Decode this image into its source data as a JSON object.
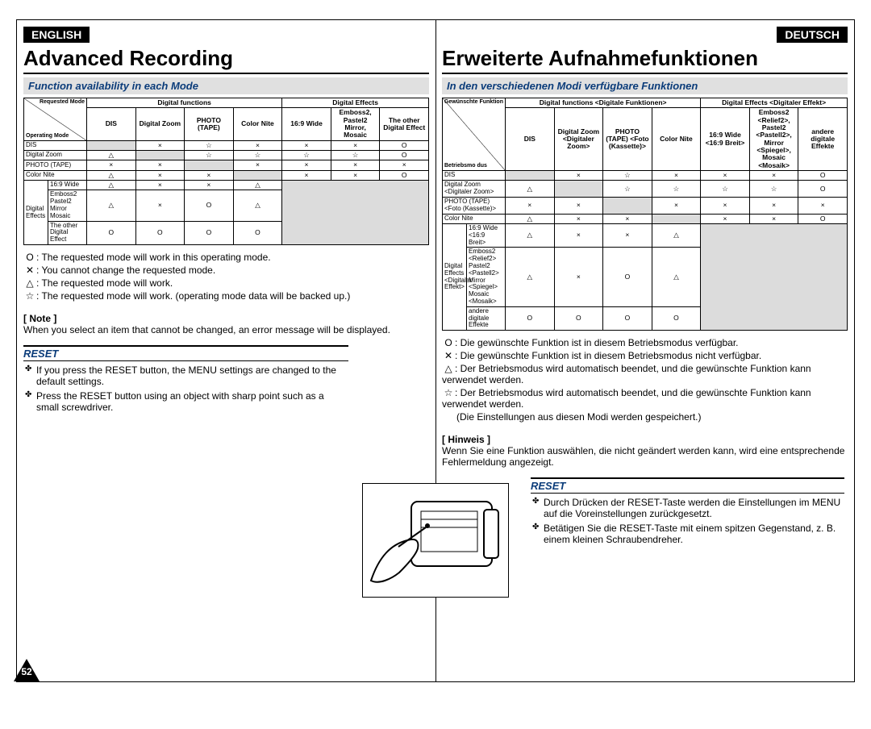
{
  "page_number": "52",
  "en": {
    "lang": "ENGLISH",
    "title": "Advanced Recording",
    "subhead": "Function availability in each Mode",
    "table": {
      "diag_top": "Requested Mode",
      "diag_left": "Operating Mode",
      "group1": "Digital functions",
      "group2": "Digital Effects",
      "cols": [
        "DIS",
        "Digital Zoom",
        "PHOTO (TAPE)",
        "Color Nite",
        "16:9 Wide",
        "Emboss2, Pastel2 Mirror, Mosaic",
        "The other Digital Effect"
      ],
      "rows": [
        {
          "h": "DIS",
          "sh": true,
          "c": [
            "",
            "×",
            "☆",
            "×",
            "×",
            "×",
            "O"
          ]
        },
        {
          "h": "Digital Zoom",
          "sh": false,
          "c": [
            "△",
            "",
            "☆",
            "☆",
            "☆",
            "☆",
            "O"
          ]
        },
        {
          "h": "PHOTO (TAPE)",
          "sh": true,
          "c": [
            "×",
            "×",
            "",
            "×",
            "×",
            "×",
            "×"
          ]
        },
        {
          "h": "Color Nite",
          "sh": false,
          "c": [
            "△",
            "×",
            "×",
            "",
            "×",
            "×",
            "O"
          ]
        }
      ],
      "de_group_rows": [
        {
          "h": "Digital Effects",
          "sub": "16:9 Wide",
          "c": [
            "△",
            "×",
            "×",
            "△",
            "",
            "",
            ""
          ]
        },
        {
          "h": "",
          "sub": "Emboss2 Pastel2 Mirror Mosaic",
          "c": [
            "△",
            "×",
            "O",
            "△",
            "",
            "",
            ""
          ]
        },
        {
          "h": "",
          "sub": "The other Digital Effect",
          "c": [
            "O",
            "O",
            "O",
            "O",
            "",
            "",
            ""
          ]
        }
      ]
    },
    "legend": [
      {
        "s": "O",
        "t": ": The requested mode will work in this operating mode."
      },
      {
        "s": "✕",
        "t": ": You cannot change the requested mode."
      },
      {
        "s": "△",
        "t": ": The requested mode will work."
      },
      {
        "s": "☆",
        "t": ": The requested mode will work. (operating mode data will be backed up.)"
      }
    ],
    "note_lbl": "[ Note ]",
    "note_txt": "When you select an item that cannot be changed, an error message will be displayed.",
    "reset_head": "RESET",
    "reset": [
      "If you press the RESET button, the MENU settings are changed to the default settings.",
      "Press the RESET button using an object with sharp point such as a small screwdriver."
    ]
  },
  "de": {
    "lang": "DEUTSCH",
    "title": "Erweiterte Aufnahmefunktionen",
    "subhead": "In den verschiedenen Modi verfügbare Funktionen",
    "table": {
      "diag_top": "Gewünschte Funktion",
      "diag_left": "Betriebsmo dus",
      "group1": "Digital functions <Digitale Funktionen>",
      "group2": "Digital Effects <Digitaler Effekt>",
      "cols": [
        "DIS",
        "Digital Zoom <Digitaler Zoom>",
        "PHOTO (TAPE) <Foto (Kassette)>",
        "Color Nite",
        "16:9 Wide <16:9 Breit>",
        "Emboss2 <Relief2>, Pastel2 <Pastell2>, Mirror <Spiegel>, Mosaic <Mosaik>",
        "andere digitale Effekte"
      ],
      "rows": [
        {
          "h": "DIS",
          "sh": true,
          "c": [
            "",
            "×",
            "☆",
            "×",
            "×",
            "×",
            "O"
          ]
        },
        {
          "h": "Digital Zoom <Digitaler Zoom>",
          "sh": false,
          "c": [
            "△",
            "",
            "☆",
            "☆",
            "☆",
            "☆",
            "O"
          ]
        },
        {
          "h": "PHOTO (TAPE) <Foto (Kassette)>",
          "sh": true,
          "c": [
            "×",
            "×",
            "",
            "×",
            "×",
            "×",
            "×"
          ]
        },
        {
          "h": "Color Nite",
          "sh": false,
          "c": [
            "△",
            "×",
            "×",
            "",
            "×",
            "×",
            "O"
          ]
        }
      ],
      "de_group_rows": [
        {
          "h": "Digital Effects <Digitaler Effekt>",
          "sub": "16:9 Wide <16:9 Breit>",
          "c": [
            "△",
            "×",
            "×",
            "△",
            "",
            "",
            ""
          ]
        },
        {
          "h": "",
          "sub": "Emboss2 <Relief2> Pastel2 <Pastell2> Mirror <Spiegel> Mosaic <Mosaik>",
          "c": [
            "△",
            "×",
            "O",
            "△",
            "",
            "",
            ""
          ]
        },
        {
          "h": "",
          "sub": "andere digitale Effekte",
          "c": [
            "O",
            "O",
            "O",
            "O",
            "",
            "",
            ""
          ]
        }
      ]
    },
    "legend": [
      {
        "s": "O",
        "t": ": Die gewünschte Funktion ist in diesem Betriebsmodus verfügbar."
      },
      {
        "s": "✕",
        "t": ": Die gewünschte Funktion ist in diesem Betriebsmodus nicht verfügbar."
      },
      {
        "s": "△",
        "t": ": Der Betriebsmodus wird automatisch beendet, und die gewünschte Funktion kann verwendet werden."
      },
      {
        "s": "☆",
        "t": ": Der Betriebsmodus wird automatisch beendet, und die gewünschte Funktion kann verwendet werden."
      }
    ],
    "legend_extra": "(Die Einstellungen aus diesen Modi werden gespeichert.)",
    "note_lbl": "[ Hinweis ]",
    "note_txt": "Wenn Sie eine Funktion auswählen, die nicht geändert werden kann, wird eine entsprechende Fehlermeldung angezeigt.",
    "reset_head": "RESET",
    "reset": [
      "Durch Drücken der RESET-Taste werden die Einstellungen im MENU auf die Voreinstellungen zurückgesetzt.",
      "Betätigen Sie die RESET-Taste mit einem spitzen Gegenstand, z. B. einem kleinen Schraubendreher."
    ]
  }
}
